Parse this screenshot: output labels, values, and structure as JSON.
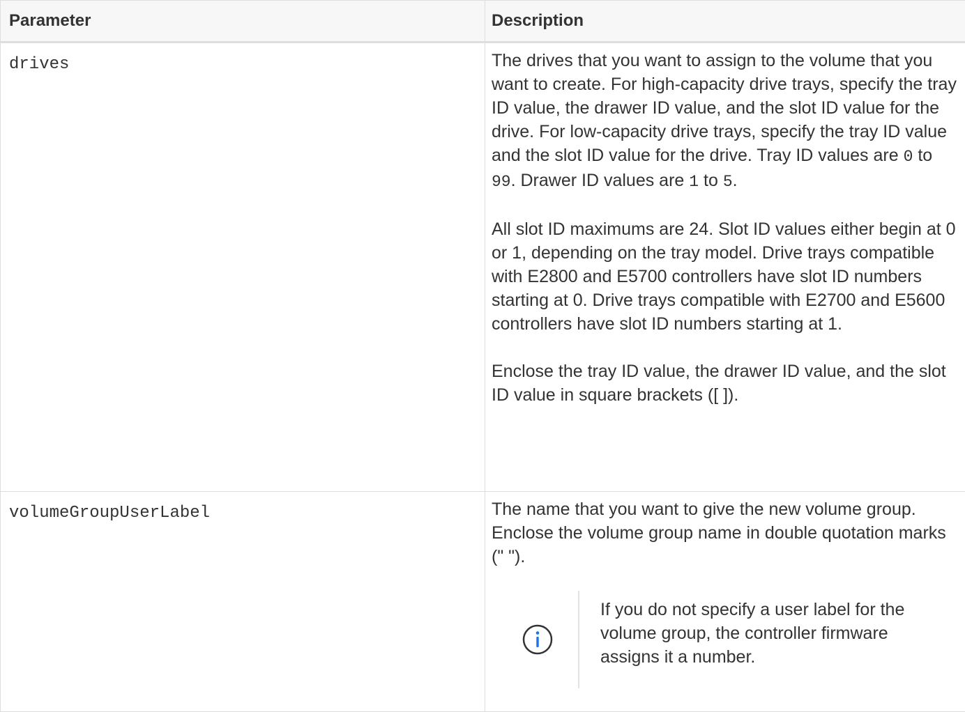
{
  "table": {
    "headers": {
      "parameter": "Parameter",
      "description": "Description"
    },
    "rows": [
      {
        "parameter": "drives",
        "paragraphs": {
          "p1": {
            "text_a": "The drives that you want to assign to the volume that you want to create. For high-capacity drive trays, specify the tray ID value, the drawer ID value, and the slot ID value for the drive. For low-capacity drive trays, specify the tray ID value and the slot ID value for the drive. Tray ID values are ",
            "code_a": "0",
            "text_b": " to ",
            "code_b": "99",
            "text_c": ". Drawer ID values are ",
            "code_c": "1",
            "text_d": " to ",
            "code_d": "5",
            "text_e": "."
          },
          "p2": "All slot ID maximums are 24. Slot ID values either begin at 0 or 1, depending on the tray model. Drive trays compatible with E2800 and E5700 controllers have slot ID numbers starting at 0. Drive trays compatible with E2700 and E5600 controllers have slot ID numbers starting at 1.",
          "p3": "Enclose the tray ID value, the drawer ID value, and the slot ID value in square brackets ([ ])."
        }
      },
      {
        "parameter": "volumeGroupUserLabel",
        "paragraphs": {
          "p1": "The name that you want to give the new volume group. Enclose the volume group name in double quotation marks (\" \")."
        },
        "note": {
          "icon": "info-circle-icon",
          "text": "If you do not specify a user label for the volume group, the controller firmware assigns it a number."
        }
      }
    ]
  },
  "colors": {
    "border": "#dedede",
    "header_bg": "#f7f7f8",
    "text": "#333333",
    "info_icon": "#1a73e8"
  }
}
